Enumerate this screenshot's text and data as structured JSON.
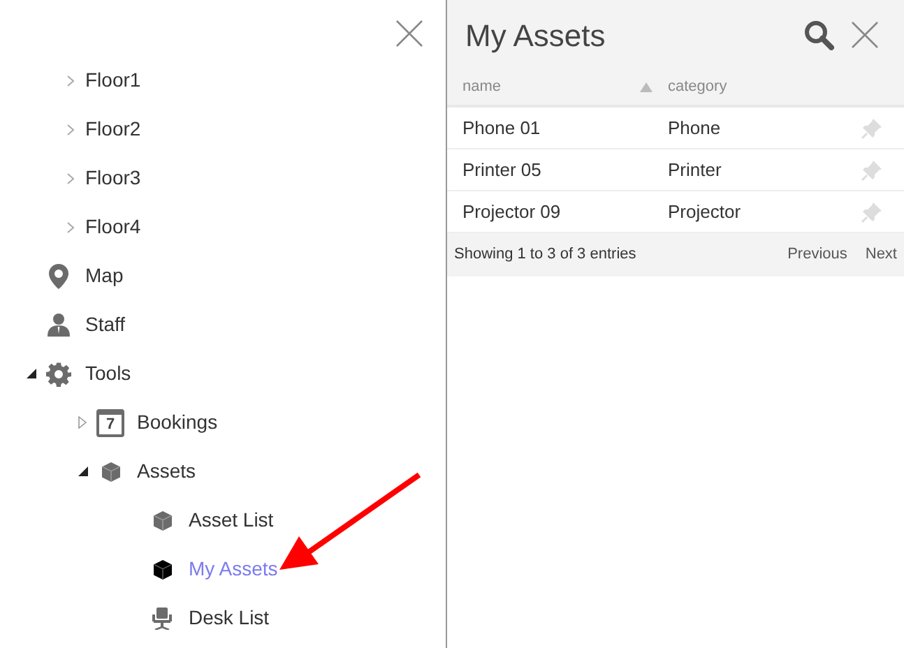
{
  "floors": [
    {
      "label": "Floor1",
      "expanded": false
    },
    {
      "label": "Floor2",
      "expanded": false
    },
    {
      "label": "Floor3",
      "expanded": false
    },
    {
      "label": "Floor4",
      "expanded": false
    }
  ],
  "tree": [
    {
      "label": "Map",
      "kind": "pin",
      "selected": false
    },
    {
      "label": "Staff",
      "kind": "person",
      "selected": false
    },
    {
      "label": "Tools",
      "kind": "gear",
      "expanded": true,
      "selected": false,
      "children": [
        {
          "label": "Bookings",
          "kind": "calendar",
          "icon_label": "7",
          "expanded": false,
          "selected": false
        },
        {
          "label": "Assets",
          "kind": "cube",
          "expanded": true,
          "selected": false,
          "children": [
            {
              "label": "Asset List",
              "kind": "cube",
              "selected": false
            },
            {
              "label": "My Assets",
              "kind": "cube",
              "selected": true
            },
            {
              "label": "Desk List",
              "kind": "chair",
              "selected": false
            }
          ]
        }
      ]
    }
  ],
  "panel": {
    "title": "My Assets",
    "columns": [
      {
        "label": "name",
        "sorted": true
      },
      {
        "label": "category",
        "sorted": false
      }
    ],
    "rows": [
      {
        "cells": [
          "Phone 01",
          "Phone"
        ],
        "pinned": false
      },
      {
        "cells": [
          "Printer 05",
          "Printer"
        ],
        "pinned": false
      },
      {
        "cells": [
          "Projector 09",
          "Projector"
        ],
        "pinned": false
      }
    ],
    "info": "Showing 1 to 3 of 3 entries",
    "pager": [
      "Previous",
      "Next"
    ]
  }
}
